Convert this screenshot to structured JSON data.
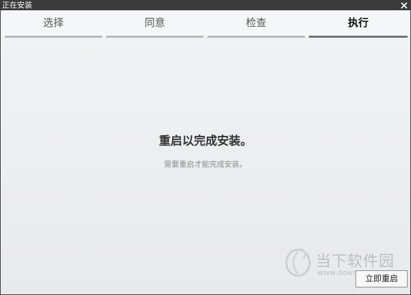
{
  "window": {
    "title": "正在安装",
    "close_icon": "close-icon"
  },
  "steps": [
    {
      "label": "选择",
      "state": "done"
    },
    {
      "label": "同意",
      "state": "done"
    },
    {
      "label": "检查",
      "state": "done"
    },
    {
      "label": "执行",
      "state": "active"
    }
  ],
  "message": {
    "title": "重启以完成安装。",
    "subtitle": "需要重启才能完成安装。"
  },
  "watermark": {
    "name": "当下软件园",
    "url": "www.downxia.com"
  },
  "actions": {
    "restart_label": "立即重启"
  },
  "colors": {
    "titlebar": "#3b3b3b",
    "step_bar": "#b6b8bc",
    "step_bar_active": "#6e7276",
    "content_bg": "#ebecee"
  }
}
